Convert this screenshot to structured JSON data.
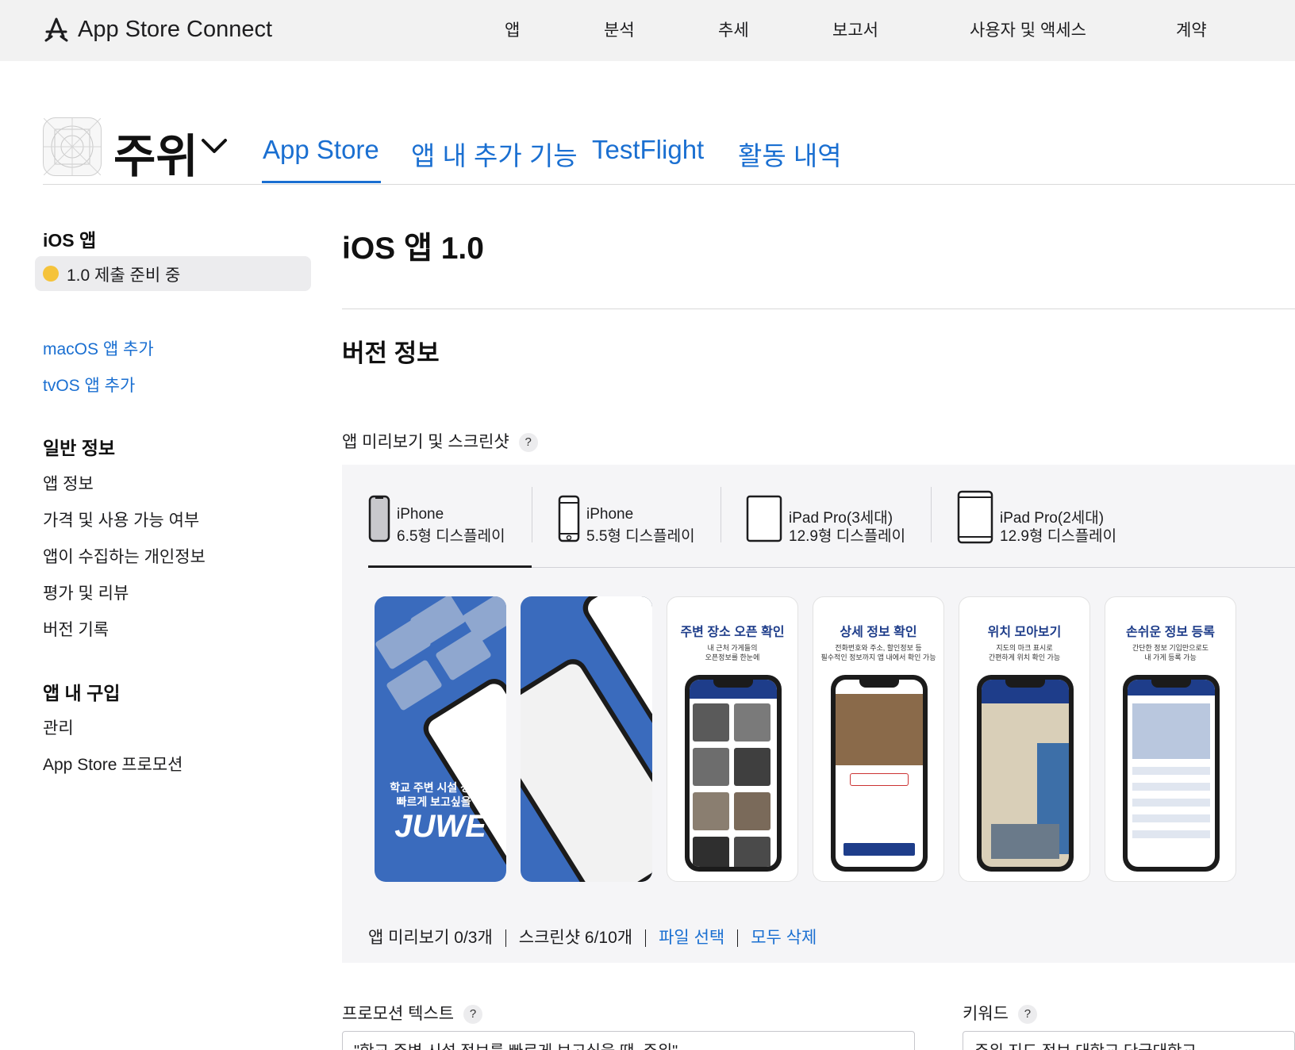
{
  "topbar": {
    "brand": "App Store Connect",
    "nav": [
      "앱",
      "분석",
      "추세",
      "보고서",
      "사용자 및 액세스",
      "계약"
    ]
  },
  "app": {
    "name": "주위",
    "tabs": [
      "App Store",
      "앱 내 추가 기능",
      "TestFlight",
      "활동 내역"
    ],
    "active_tab": "App Store"
  },
  "sidebar": {
    "ios_heading": "iOS 앱",
    "status": {
      "label": "1.0 제출 준비 중",
      "color": "#f5c33b"
    },
    "add_links": [
      "macOS 앱 추가",
      "tvOS 앱 추가"
    ],
    "general_heading": "일반 정보",
    "general_items": [
      "앱 정보",
      "가격 및 사용 가능 여부",
      "앱이 수집하는 개인정보",
      "평가 및 리뷰",
      "버전 기록"
    ],
    "iap_heading": "앱 내 구입",
    "iap_items": [
      "관리",
      "App Store 프로모션"
    ]
  },
  "main": {
    "title": "iOS 앱 1.0",
    "section_title": "버전 정보",
    "media_label": "앱 미리보기 및 스크린샷",
    "help_glyph": "?",
    "devices": [
      {
        "name": "iPhone",
        "size": "6.5형 디스플레이",
        "icon": "iphone-filled-icon"
      },
      {
        "name": "iPhone",
        "size": "5.5형 디스플레이",
        "icon": "iphone-home-button-icon"
      },
      {
        "name": "iPad Pro(3세대)",
        "size": "12.9형 디스플레이",
        "icon": "ipad-icon"
      },
      {
        "name": "iPad Pro(2세대)",
        "size": "12.9형 디스플레이",
        "icon": "ipad-home-button-icon"
      }
    ],
    "screenshots": [
      {
        "kind": "promo",
        "caption": "학교 주변 시설 정보를\n빠르게 보고싶을 땐",
        "brand": "JUWE"
      },
      {
        "kind": "promo2"
      },
      {
        "kind": "feature",
        "title": "주변 장소 오픈 확인",
        "subtitle": "내 근처 가게들의\n오픈정보를 한눈에"
      },
      {
        "kind": "feature",
        "title": "상세 정보 확인",
        "subtitle": "전화번호와 주소, 할인정보 등\n필수적인 정보까지 앱 내에서 확인 가능"
      },
      {
        "kind": "feature",
        "title": "위치 모아보기",
        "subtitle": "지도의 마크 표시로\n간편하게 위치 확인 가능"
      },
      {
        "kind": "feature",
        "title": "손쉬운 정보 등록",
        "subtitle": "간단한 정보 기입만으로도\n내 가게 등록 가능"
      }
    ],
    "counts": {
      "previews": "앱 미리보기 0/3개",
      "screenshots": "스크린샷 6/10개",
      "choose_file": "파일 선택",
      "delete_all": "모두 삭제"
    },
    "promo_label": "프로모션 텍스트",
    "promo_value": "\"학교 주변 시설 정보를 빠르게 보고싶을 땐, 주위\"",
    "keywords_label": "키워드",
    "keywords_value": "주위,지도,정보,대학교,단국대학교"
  },
  "colors": {
    "accent": "#1a6fd1",
    "topbar_bg": "#f2f2f2",
    "panel_bg": "#f5f5f7",
    "promo_blue": "#3a6bbd"
  }
}
